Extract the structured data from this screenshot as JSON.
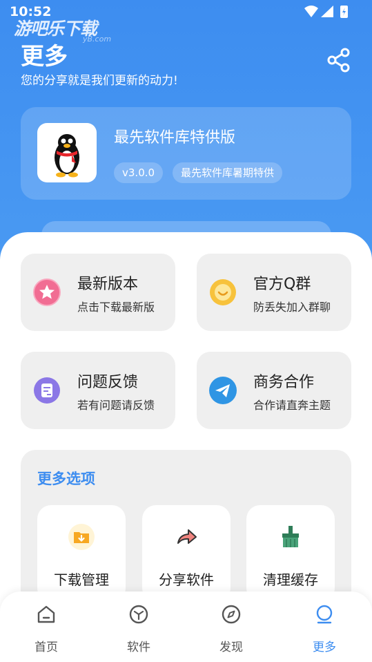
{
  "status_bar": {
    "time": "10:52"
  },
  "watermark": {
    "text": "游吧乐下载",
    "sub": "yB.com"
  },
  "header": {
    "title": "更多",
    "subtitle": "您的分享就是我们更新的动力!",
    "share_icon": "share-icon"
  },
  "app_card": {
    "name": "最先软件库特供版",
    "version": "v3.0.0",
    "edition": "最先软件库暑期特供",
    "icon": "penguin-icon"
  },
  "tiles": [
    {
      "title": "最新版本",
      "subtitle": "点击下载最新版",
      "icon": "star-icon",
      "color": "#f16d93"
    },
    {
      "title": "官方Q群",
      "subtitle": "防丢失加入群聊",
      "icon": "smile-icon",
      "color": "#f7c23c"
    },
    {
      "title": "问题反馈",
      "subtitle": "若有问题请反馈",
      "icon": "feedback-icon",
      "color": "#8b77e6"
    },
    {
      "title": "商务合作",
      "subtitle": "合作请直奔主题",
      "icon": "send-icon",
      "color": "#2f95e4"
    }
  ],
  "more_options": {
    "heading": "更多选项",
    "items": [
      {
        "label": "下载管理",
        "icon": "download-folder-icon",
        "color": "#f7a823"
      },
      {
        "label": "分享软件",
        "icon": "share-arrow-icon",
        "color": "#f0847f"
      },
      {
        "label": "清理缓存",
        "icon": "broom-icon",
        "color": "#4aa37a"
      }
    ]
  },
  "bottom_nav": {
    "items": [
      {
        "label": "首页",
        "icon": "home-icon"
      },
      {
        "label": "软件",
        "icon": "cube-icon"
      },
      {
        "label": "发现",
        "icon": "compass-icon"
      },
      {
        "label": "更多",
        "icon": "circle-icon"
      }
    ],
    "active_index": 3,
    "active_color": "#3d8df0"
  },
  "colors": {
    "accent": "#3d8df0"
  }
}
